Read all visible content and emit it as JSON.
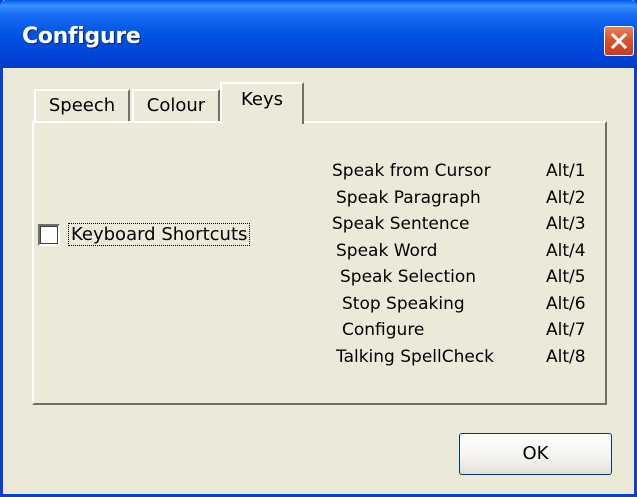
{
  "window": {
    "title": "Configure"
  },
  "tabs": [
    {
      "label": "Speech",
      "selected": false
    },
    {
      "label": "Colour",
      "selected": false
    },
    {
      "label": "Keys",
      "selected": true
    }
  ],
  "keyboard_shortcuts": {
    "label": "Keyboard Shortcuts",
    "checked": false
  },
  "shortcuts": [
    {
      "action": "Speak from Cursor",
      "key": "Alt/1"
    },
    {
      "action": "Speak Paragraph",
      "key": "Alt/2"
    },
    {
      "action": "Speak Sentence",
      "key": "Alt/3"
    },
    {
      "action": "Speak Word",
      "key": "Alt/4"
    },
    {
      "action": "Speak Selection",
      "key": "Alt/5"
    },
    {
      "action": "Stop Speaking",
      "key": "Alt/6"
    },
    {
      "action": "Configure",
      "key": "Alt/7"
    },
    {
      "action": "Talking SpellCheck",
      "key": "Alt/8"
    }
  ],
  "buttons": {
    "ok_label": "OK"
  },
  "colors": {
    "titlebar": "#0053e1",
    "close_button": "#d8532d",
    "dialog_background": "#ece9d8"
  },
  "icons": {
    "close": "close-icon"
  }
}
